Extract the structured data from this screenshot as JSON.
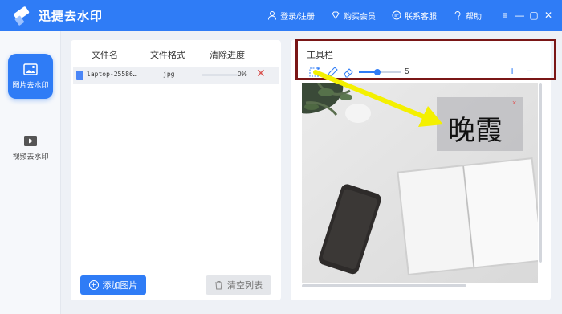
{
  "app": {
    "title": "迅捷去水印"
  },
  "titlebar": {
    "login": "登录/注册",
    "buy": "购买会员",
    "support": "联系客服",
    "help": "帮助"
  },
  "sidebar": {
    "items": [
      {
        "label": "图片去水印",
        "icon": "image-icon",
        "active": true
      },
      {
        "label": "视频去水印",
        "icon": "video-icon",
        "active": false
      }
    ]
  },
  "file_panel": {
    "columns": [
      "文件名",
      "文件格式",
      "清除进度"
    ],
    "rows": [
      {
        "name": "laptop-25586…",
        "format": "jpg",
        "progress": 0,
        "progress_label": "0%"
      }
    ],
    "add_button": "添加图片",
    "clear_button": "清空列表"
  },
  "toolbar": {
    "label": "工具栏",
    "tools": [
      "rect-select-icon",
      "pen-icon",
      "eraser-icon"
    ],
    "brush_size": 5,
    "brush_size_label": "5",
    "zoom_in": "+",
    "zoom_out": "−"
  },
  "watermark": {
    "text": "晚霞",
    "close": "×"
  },
  "colors": {
    "brand": "#2f7cf6",
    "highlight_border": "#7a1616",
    "arrow": "#f4f000",
    "delete": "#d9534f"
  }
}
